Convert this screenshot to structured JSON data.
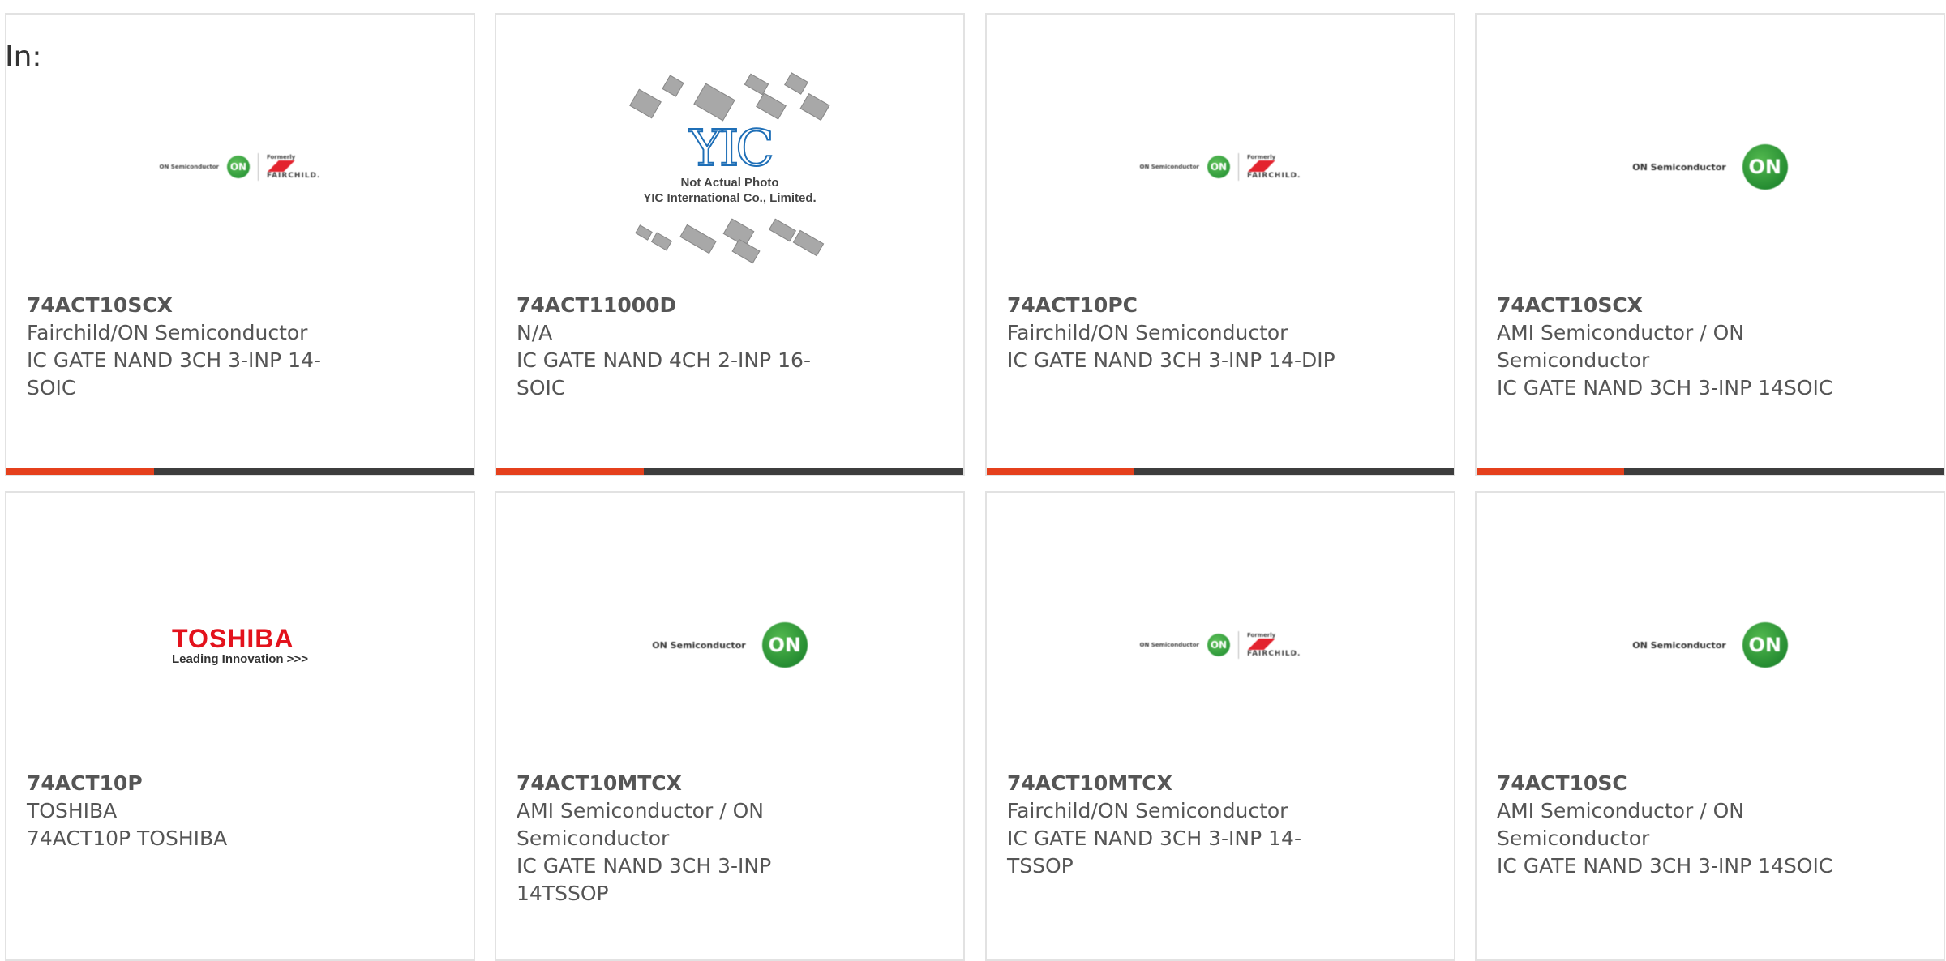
{
  "header": {
    "in_label": "In:"
  },
  "cards": [
    {
      "logo": "onsemi-fairchild-logo",
      "part_number": "74ACT10SCX",
      "manufacturer": "Fairchild/ON Semiconductor",
      "description": "IC GATE NAND 3CH 3-INP 14-SOIC"
    },
    {
      "logo": "yic-placeholder-photo",
      "logo_caption_line1": "Not Actual Photo",
      "logo_caption_line2": "YIC International Co., Limited.",
      "logo_mark": "YIC",
      "part_number": "74ACT11000D",
      "manufacturer": "N/A",
      "description": "IC GATE NAND 4CH 2-INP 16-SOIC"
    },
    {
      "logo": "onsemi-fairchild-logo",
      "part_number": "74ACT10PC",
      "manufacturer": "Fairchild/ON Semiconductor",
      "description": "IC GATE NAND 3CH 3-INP 14-DIP"
    },
    {
      "logo": "onsemi-logo",
      "part_number": "74ACT10SCX",
      "manufacturer": "AMI Semiconductor / ON Semiconductor",
      "description": "IC GATE NAND 3CH 3-INP 14SOIC"
    },
    {
      "logo": "toshiba-logo",
      "logo_word": "TOSHIBA",
      "logo_tagline": "Leading Innovation >>>",
      "part_number": "74ACT10P",
      "manufacturer": "TOSHIBA",
      "description": "74ACT10P TOSHIBA"
    },
    {
      "logo": "onsemi-logo",
      "part_number": "74ACT10MTCX",
      "manufacturer": "AMI Semiconductor / ON Semiconductor",
      "description": "IC GATE NAND 3CH 3-INP 14TSSOP"
    },
    {
      "logo": "onsemi-fairchild-logo",
      "part_number": "74ACT10MTCX",
      "manufacturer": "Fairchild/ON Semiconductor",
      "description": "IC GATE NAND 3CH 3-INP 14-TSSOP"
    },
    {
      "logo": "onsemi-logo",
      "part_number": "74ACT10SC",
      "manufacturer": "AMI Semiconductor / ON Semiconductor",
      "description": "IC GATE NAND 3CH 3-INP 14SOIC"
    }
  ],
  "logo_text": {
    "on_semi_small": "ON Semiconductor",
    "on_semi": "ON Semiconductor",
    "on_mark": "ON",
    "fairchild_formerly": "Formerly",
    "fairchild_word": "FAIRCHILD."
  },
  "colors": {
    "accent": "#e5401c",
    "bar_dark": "#3d3d3d",
    "text": "#555555",
    "border": "#e2e2e2"
  }
}
